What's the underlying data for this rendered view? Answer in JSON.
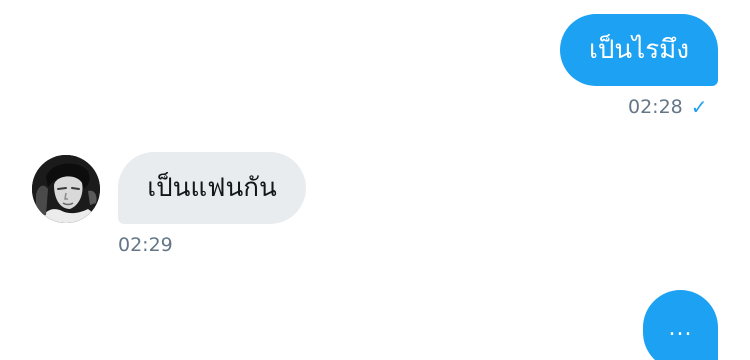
{
  "conversation": {
    "messages": [
      {
        "direction": "outgoing",
        "text": "เป็นไรมึง",
        "time": "02:28",
        "status_icon": "check-icon"
      },
      {
        "direction": "incoming",
        "text": "เป็นแฟนกัน",
        "time": "02:29",
        "sender_avatar": "avatar-image"
      },
      {
        "direction": "outgoing",
        "text": "..."
      }
    ]
  },
  "colors": {
    "outgoing_bubble": "#1da1f2",
    "incoming_bubble": "#e8ecef",
    "timestamp": "#657786"
  }
}
